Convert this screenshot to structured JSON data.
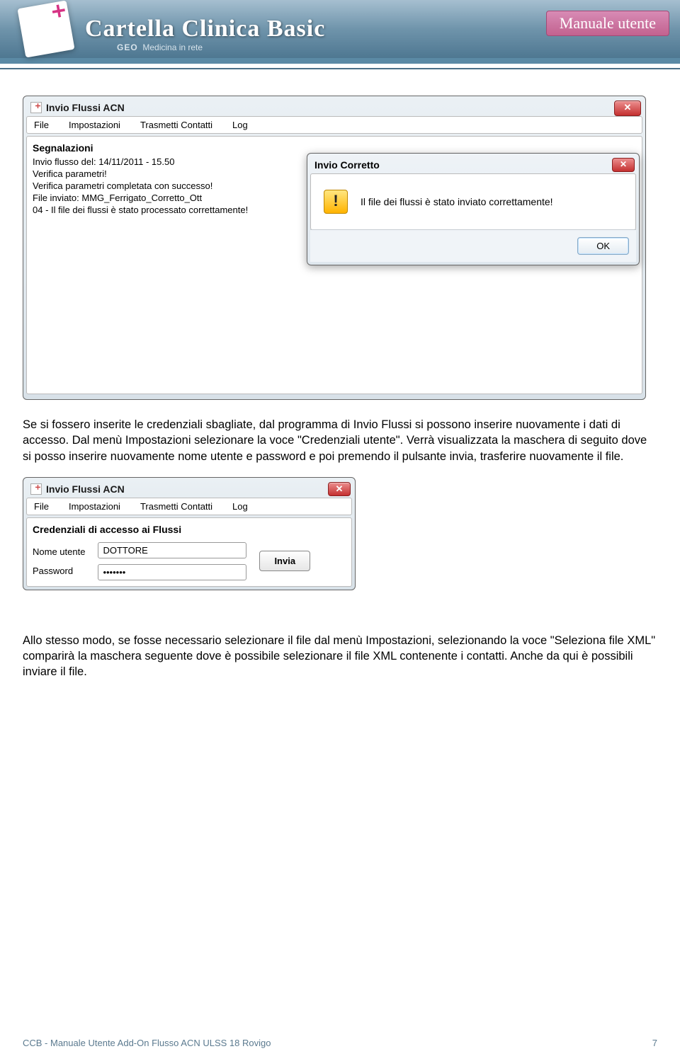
{
  "header": {
    "title": "Cartella Clinica Basic",
    "subtitle_brand": "GEO",
    "subtitle_text": "Medicina in rete",
    "badge": "Manuale utente"
  },
  "window1": {
    "title": "Invio Flussi ACN",
    "menu": {
      "file": "File",
      "impostazioni": "Impostazioni",
      "trasmetti": "Trasmetti Contatti",
      "log": "Log"
    },
    "group_title": "Segnalazioni",
    "log": [
      "Invio flusso del: 14/11/2011 - 15.50",
      "Verifica parametri!",
      "Verifica parametri completata con successo!",
      "File inviato: MMG_Ferrigato_Corretto_Ott",
      "04 - Il file dei flussi è stato processato correttamente!"
    ]
  },
  "dialog": {
    "title": "Invio Corretto",
    "message": "Il file dei flussi è stato inviato correttamente!",
    "ok": "OK"
  },
  "para1": "Se si fossero inserite le credenziali sbagliate, dal programma di Invio Flussi si possono inserire nuovamente i dati di accesso. Dal menù Impostazioni selezionare la voce \"Credenziali utente\". Verrà visualizzata la maschera di seguito dove si posso inserire nuovamente nome utente e password e poi premendo il pulsante invia, trasferire nuovamente il file.",
  "window2": {
    "title": "Invio Flussi ACN",
    "menu": {
      "file": "File",
      "impostazioni": "Impostazioni",
      "trasmetti": "Trasmetti Contatti",
      "log": "Log"
    },
    "group_title": "Credenziali di accesso ai Flussi",
    "label_user": "Nome utente",
    "label_pass": "Password",
    "value_user": "DOTTORE",
    "value_pass": "•••••••",
    "btn_invia": "Invia"
  },
  "para2": "Allo stesso modo, se fosse necessario selezionare il file dal menù Impostazioni, selezionando la voce \"Seleziona file XML\" comparirà la maschera seguente dove è possibile selezionare il file XML contenente i contatti. Anche da qui è possibili inviare il file.",
  "footer": {
    "left": "CCB - Manuale Utente  Add-On  Flusso ACN ULSS 18 Rovigo",
    "right": "7"
  }
}
